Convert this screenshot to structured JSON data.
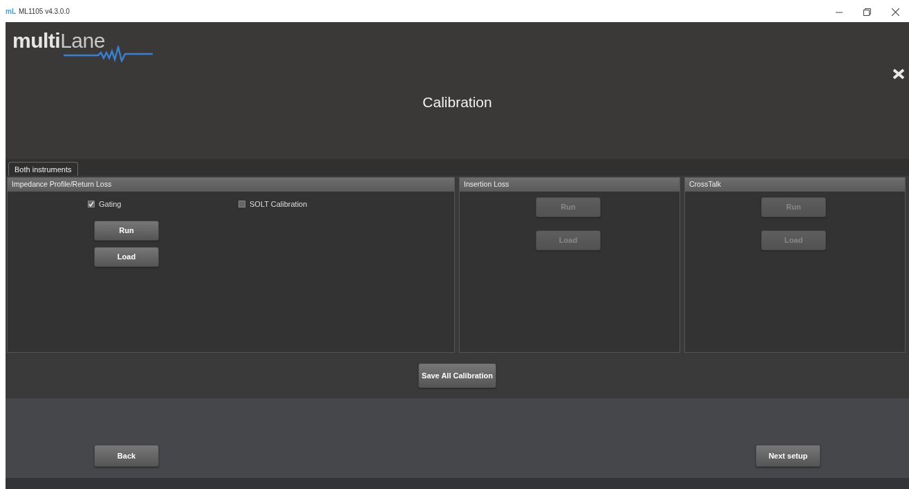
{
  "window": {
    "title": "ML1105 v4.3.0.0",
    "app_icon_text": "mL"
  },
  "logo": {
    "part_1": "multi",
    "part_2": "Lane"
  },
  "page_title": "Calibration",
  "tabs": [
    {
      "label": "Both instruments",
      "selected": true
    }
  ],
  "panels": [
    {
      "title": "Impedance Profile/Return Loss",
      "options": [
        {
          "label": "Gating",
          "checked": true
        },
        {
          "label": "SOLT Calibration",
          "checked": false
        }
      ],
      "buttons": [
        {
          "label": "Run",
          "disabled": false
        },
        {
          "label": "Load",
          "disabled": false
        }
      ]
    },
    {
      "title": "Insertion Loss",
      "buttons": [
        {
          "label": "Run",
          "disabled": true
        },
        {
          "label": "Load",
          "disabled": true
        }
      ]
    },
    {
      "title": "CrossTalk",
      "buttons": [
        {
          "label": "Run",
          "disabled": true
        },
        {
          "label": "Load",
          "disabled": true
        }
      ]
    }
  ],
  "save_button": "Save All Calibration",
  "nav_buttons": [
    {
      "label": "Back"
    },
    {
      "label": "Next setup"
    }
  ]
}
